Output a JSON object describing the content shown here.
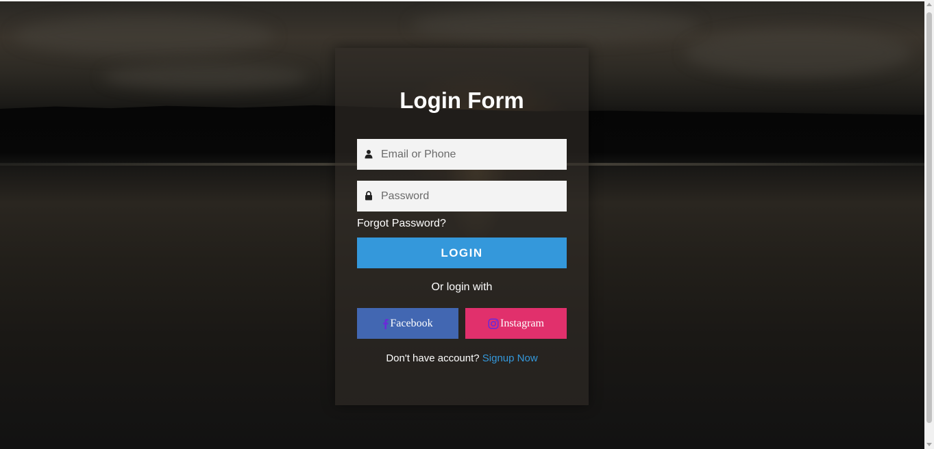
{
  "form": {
    "title": "Login Form",
    "email_placeholder": "Email or Phone",
    "password_placeholder": "Password",
    "forgot_label": "Forgot Password?",
    "login_label": "LOGIN",
    "or_label": "Or login with",
    "facebook_label": "Facebook",
    "instagram_label": "Instagram",
    "no_account_label": "Don't have account?",
    "signup_label": "Signup Now"
  },
  "colors": {
    "accent": "#3498db",
    "facebook": "#4267b2",
    "instagram": "#e1306c"
  },
  "icons": {
    "email": "user-icon",
    "password": "lock-icon",
    "facebook": "facebook-icon",
    "instagram": "instagram-icon"
  }
}
